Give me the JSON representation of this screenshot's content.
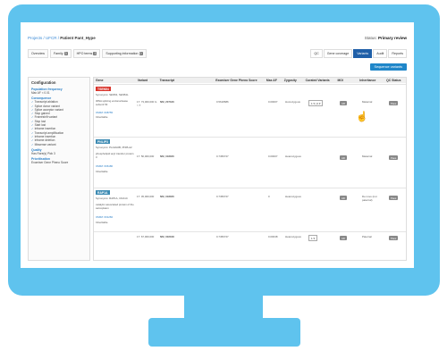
{
  "breadcrumb": {
    "projects": "Projects",
    "project": "UFCR",
    "current": "Patient Pant_Hype"
  },
  "status": {
    "label": "Status:",
    "value": "Primary review"
  },
  "tabs": [
    {
      "label": "Overview"
    },
    {
      "label": "Family",
      "count": "3"
    },
    {
      "label": "HPO terms",
      "count": "3"
    },
    {
      "label": "Supporting information",
      "count": "0"
    }
  ],
  "right_tabs": [
    "QC",
    "Gene coverage",
    "Variants",
    "Audit",
    "Reports"
  ],
  "sequence_button": "Sequence variants",
  "sidebar": {
    "title": "Configuration",
    "sections": [
      {
        "name": "Population frequency",
        "items": [
          "Max AF  < 0.01"
        ]
      },
      {
        "name": "Consequence",
        "items": [
          "Transcript ablation",
          "Splice donor variant",
          "Splice acceptor variant",
          "Stop gained",
          "Frameshift variant",
          "Stop lost",
          "Start lost",
          "Inframe insertion",
          "Transcript amplification",
          "Inframe insertion",
          "Inframe deletion",
          "Missense variant"
        ]
      },
      {
        "name": "Quality",
        "items": [
          "Has Rare(s)  Pick 3"
        ]
      },
      {
        "name": "Prioritisation",
        "items": [
          "Exomiser Gene Pheno Score"
        ]
      }
    ]
  },
  "columns": [
    "Gene",
    "Variant",
    "Transcript",
    "Exomiser Gene Pheno Score",
    "Max AF",
    "Zygosity",
    "Curated Variants",
    "MOI",
    "Inheritance",
    "QC Status"
  ],
  "rows": [
    {
      "gene": "TSEN54",
      "desc": "Synonyms: SEN54, SEN54L",
      "info": "tRNA splicing endonuclease subunit 54",
      "omim": "OMIM: 608755",
      "hgnc": "Inheritable",
      "variant": "17:   73,000,000\n   G > T",
      "transcript": "NM_207346",
      "score": "0.5618686",
      "maxaf": "0.00007",
      "zyg": "Homozygous",
      "inheritance": "Maternal"
    },
    {
      "gene": "PNLIP3",
      "desc": "Synonyms: PLA2G6B, PNPLA2",
      "info": "phospholipid acyl transfer protein 3",
      "omim": "OMIM: 606180",
      "hgnc": "Inheritable",
      "variant": "17:   50,000,000",
      "transcript": "NM_018026",
      "score": "0.7456727",
      "maxaf": "0.00007",
      "zyg": "Heterozygous",
      "inheritance": "Maternal"
    },
    {
      "gene": "RAP1A",
      "desc": "Synonyms: RAP1A, CDA1C",
      "info": "catalytic associated protein of the sarcoplasm",
      "omim": "OMIM: 601282",
      "hgnc": "Inheritable",
      "variant": "17:   45,000,000",
      "transcript": "NM_018026",
      "score": "0.7456727",
      "maxaf": "0",
      "zyg": "Heterozygous",
      "inheritance": "De novo (not paternal)"
    },
    {
      "gene": "",
      "desc": "",
      "info": "",
      "omim": "",
      "hgnc": "",
      "variant": "17:   67,000,000",
      "transcript": "NM_002048",
      "score": "0.7456727",
      "maxaf": "0.00048",
      "zyg": "Heterozygous",
      "inheritance": "Paternal"
    }
  ]
}
